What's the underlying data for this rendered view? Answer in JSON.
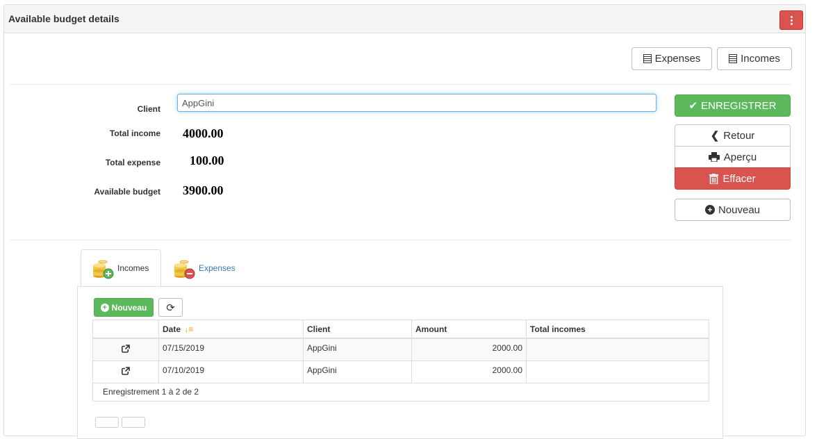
{
  "panel": {
    "title": "Available budget details"
  },
  "top_buttons": {
    "expenses": "Expenses",
    "incomes": "Incomes"
  },
  "form": {
    "client_label": "Client",
    "client_value": "AppGini",
    "total_income_label": "Total income",
    "total_income_value": "4000.00",
    "total_expense_label": "Total expense",
    "total_expense_value": "100.00",
    "available_budget_label": "Available budget",
    "available_budget_value": "3900.00"
  },
  "actions": {
    "save": "ENREGISTRER",
    "back": "Retour",
    "preview": "Aperçu",
    "delete": "Effacer",
    "new": "Nouveau"
  },
  "tabs": [
    {
      "label": "Incomes",
      "active": true
    },
    {
      "label": "Expenses",
      "active": false
    }
  ],
  "children": {
    "new_button": "Nouveau",
    "columns": [
      "Date",
      "Client",
      "Amount",
      "Total incomes"
    ],
    "rows": [
      {
        "date": "07/15/2019",
        "client": "AppGini",
        "amount": "2000.00",
        "total": ""
      },
      {
        "date": "07/10/2019",
        "client": "AppGini",
        "amount": "2000.00",
        "total": ""
      }
    ],
    "footer": "Enregistrement 1 à 2 de 2"
  },
  "colors": {
    "success": "#5cb85c",
    "danger": "#d9534f",
    "link": "#337ab7",
    "focus": "#66afe9"
  }
}
